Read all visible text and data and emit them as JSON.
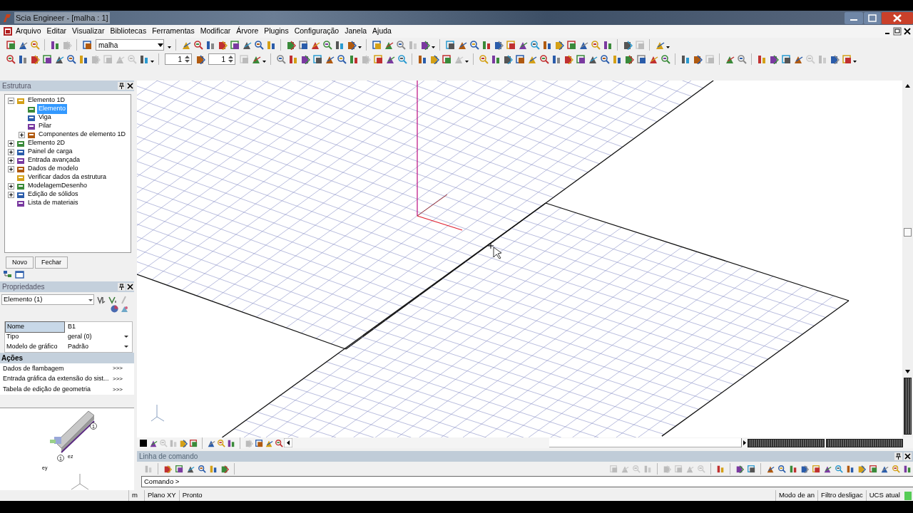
{
  "window": {
    "title": "Scia Engineer - [malha : 1]"
  },
  "menu": [
    "Arquivo",
    "Editar",
    "Visualizar",
    "Bibliotecas",
    "Ferramentas",
    "Modificar",
    "Árvore",
    "Plugins",
    "Configuração",
    "Janela",
    "Ajuda"
  ],
  "toolbar": {
    "layer_combo": {
      "value": "malha"
    },
    "spinners": [
      "1",
      "1"
    ]
  },
  "structure_panel": {
    "title": "Estrutura",
    "tree": [
      {
        "label": "Elemento 1D",
        "expanded": true,
        "selected": false,
        "children": [
          {
            "label": "Elemento",
            "selected": true
          },
          {
            "label": "Viga",
            "selected": false
          },
          {
            "label": "Pilar",
            "selected": false
          },
          {
            "label": "Componentes de elemento 1D",
            "expanded": false,
            "selected": false
          }
        ]
      },
      {
        "label": "Elemento 2D",
        "expanded": false,
        "selected": false
      },
      {
        "label": "Painel de carga",
        "expanded": false,
        "selected": false
      },
      {
        "label": "Entrada avançada",
        "expanded": false,
        "selected": false
      },
      {
        "label": "Dados de modelo",
        "expanded": false,
        "selected": false
      },
      {
        "label": "Verificar dados da estrutura",
        "selected": false
      },
      {
        "label": "ModelagemDesenho",
        "expanded": false,
        "selected": false
      },
      {
        "label": "Edição de sólidos",
        "expanded": false,
        "selected": false
      },
      {
        "label": "Lista de materiais",
        "selected": false
      }
    ],
    "buttons": [
      "Novo",
      "Fechar"
    ]
  },
  "properties_panel": {
    "title": "Propriedades",
    "selector": "Elemento (1)",
    "rows": [
      {
        "label": "Nome",
        "value": "B1",
        "selected": true,
        "dropdown": false
      },
      {
        "label": "Tipo",
        "value": "geral (0)",
        "selected": false,
        "dropdown": true
      },
      {
        "label": "Modelo de gráfico",
        "value": "Padrão",
        "selected": false,
        "dropdown": true
      }
    ]
  },
  "actions": {
    "title": "Ações",
    "items": [
      {
        "label": "Dados de flambagem",
        "link": ">>>"
      },
      {
        "label": "Entrada gráfica da extensão do sist...",
        "link": ">>>"
      },
      {
        "label": "Tabela de edição de geometria",
        "link": ">>>"
      }
    ]
  },
  "preview": {
    "labels": [
      "1",
      "1",
      "ez",
      "ey"
    ]
  },
  "command_line": {
    "title": "Linha de comando",
    "value": "Comando >"
  },
  "status_bar": {
    "unit": "m",
    "plane": "Plano XY",
    "state": "Pronto",
    "fields": [
      "Modo de an",
      "Filtro desligac",
      "UCS atual"
    ]
  }
}
